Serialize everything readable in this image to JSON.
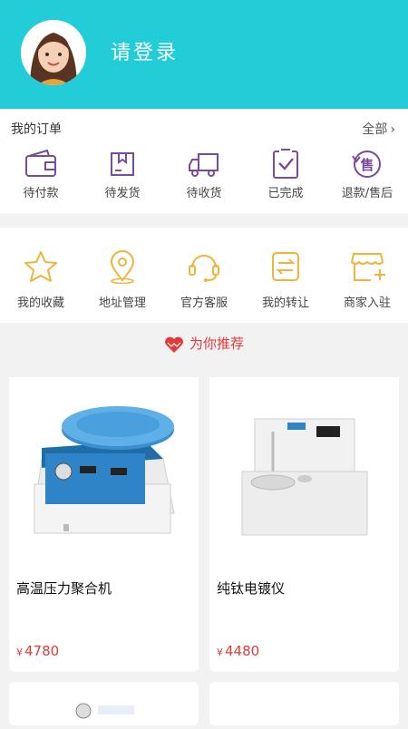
{
  "header": {
    "login_text": "请登录"
  },
  "orders": {
    "title": "我的订单",
    "all_label": "全部",
    "items": [
      {
        "label": "待付款",
        "icon": "wallet-icon"
      },
      {
        "label": "待发货",
        "icon": "package-icon"
      },
      {
        "label": "待收货",
        "icon": "truck-icon"
      },
      {
        "label": "已完成",
        "icon": "check-box-icon"
      },
      {
        "label": "退款/售后",
        "icon": "refund-icon"
      }
    ]
  },
  "services": {
    "items": [
      {
        "label": "我的收藏",
        "icon": "star-icon"
      },
      {
        "label": "地址管理",
        "icon": "location-icon"
      },
      {
        "label": "官方客服",
        "icon": "headset-icon"
      },
      {
        "label": "我的转让",
        "icon": "transfer-icon"
      },
      {
        "label": "商家入驻",
        "icon": "shop-add-icon"
      }
    ]
  },
  "recommend": {
    "title": "为你推荐"
  },
  "products": [
    {
      "name": "高温压力聚合机",
      "currency": "¥",
      "price": "4780"
    },
    {
      "name": "纯钛电镀仪",
      "currency": "¥",
      "price": "4480"
    }
  ],
  "colors": {
    "header": "#22cdd8",
    "order_icon": "#7a4a9b",
    "service_icon": "#f0b43c",
    "price": "#e23a3a"
  }
}
